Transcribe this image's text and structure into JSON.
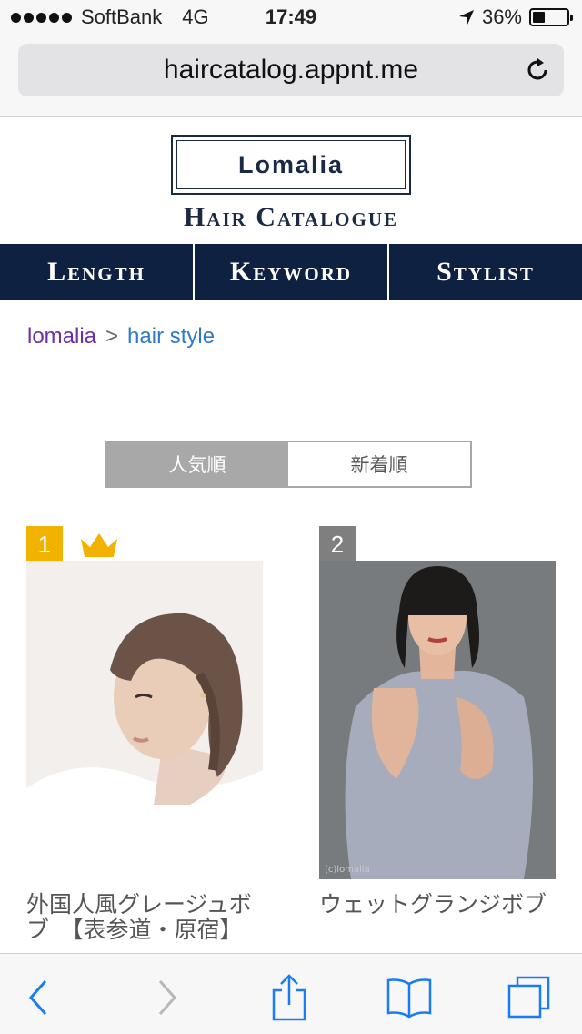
{
  "status": {
    "carrier": "SoftBank",
    "network": "4G",
    "time": "17:49",
    "battery": "36%",
    "battery_level": 0.36
  },
  "browser": {
    "url": "haircatalog.appnt.me"
  },
  "site": {
    "brand": "Lomalia",
    "subtitle": "Hair Catalogue"
  },
  "nav": [
    {
      "label": "Length"
    },
    {
      "label": "Keyword"
    },
    {
      "label": "Stylist"
    }
  ],
  "breadcrumb": {
    "home": "lomalia",
    "separator": ">",
    "current": "hair style"
  },
  "sort": {
    "popular": "人気順",
    "newest": "新着順"
  },
  "cards": [
    {
      "rank": "1",
      "title": "外国人風グレージュボブ　【表参道・原宿】"
    },
    {
      "rank": "2",
      "title": "ウェットグランジボブ",
      "watermark": "(c)lomalia"
    }
  ],
  "colors": {
    "navy": "#0e2140",
    "gold": "#f2b300",
    "link_visited": "#6b2fa8",
    "link": "#2f79c9",
    "ios_blue": "#1a7cf5"
  }
}
